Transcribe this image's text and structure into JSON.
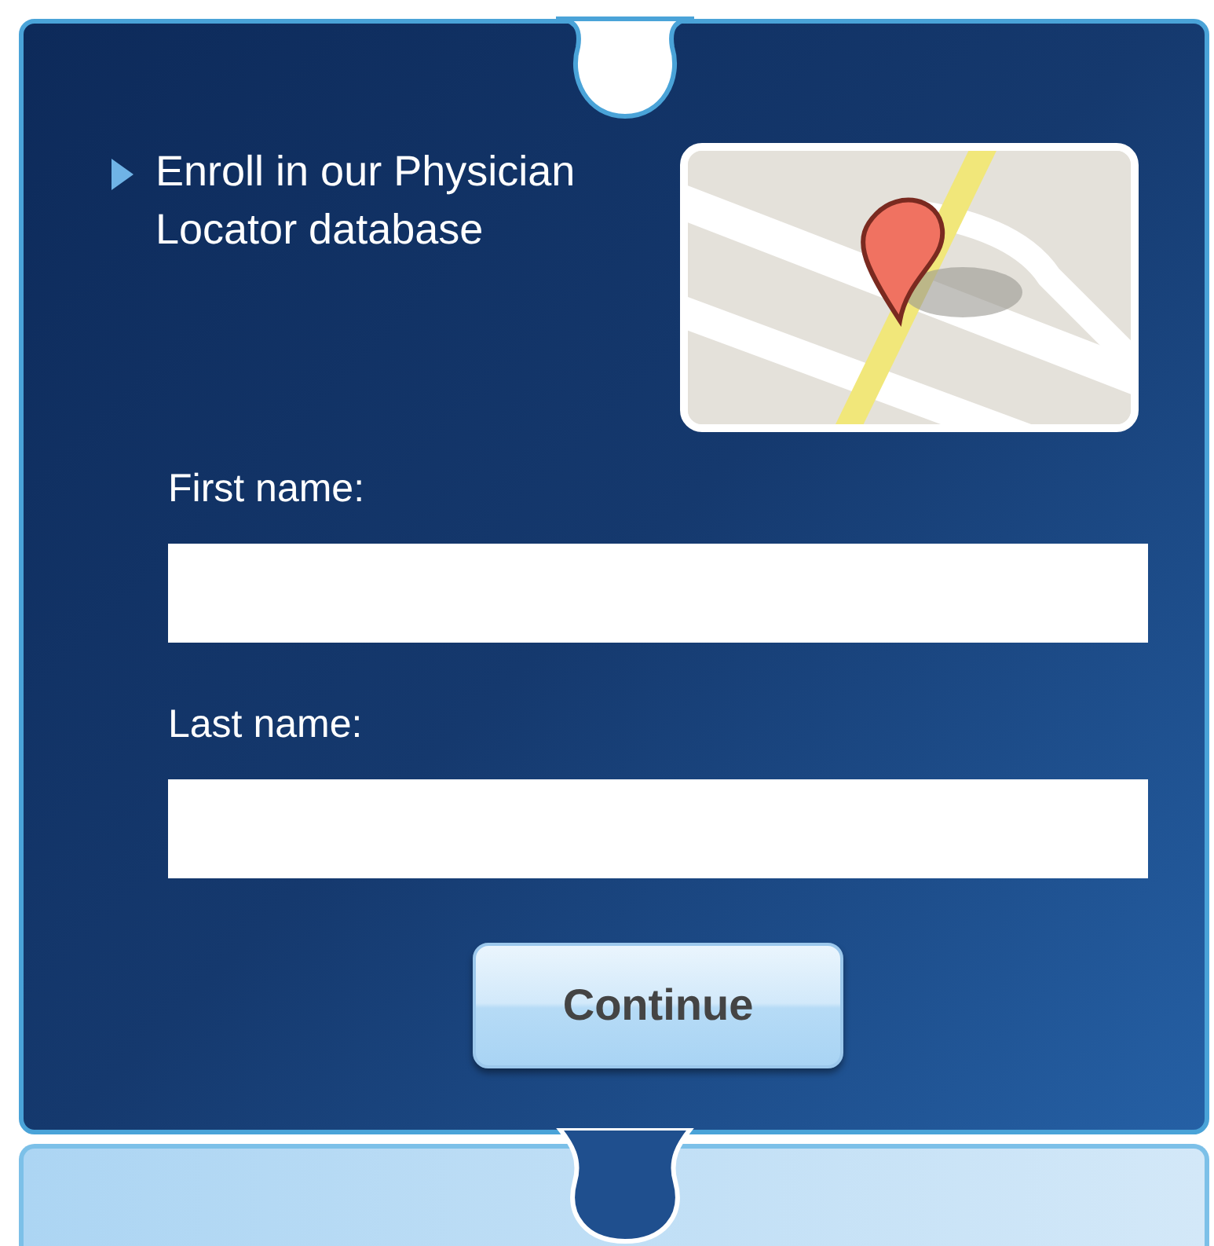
{
  "intro": {
    "text": "Enroll in our Physician Locator database"
  },
  "fields": [
    {
      "label": "First name:"
    },
    {
      "label": "Last name:"
    }
  ],
  "button": {
    "label": "Continue"
  }
}
